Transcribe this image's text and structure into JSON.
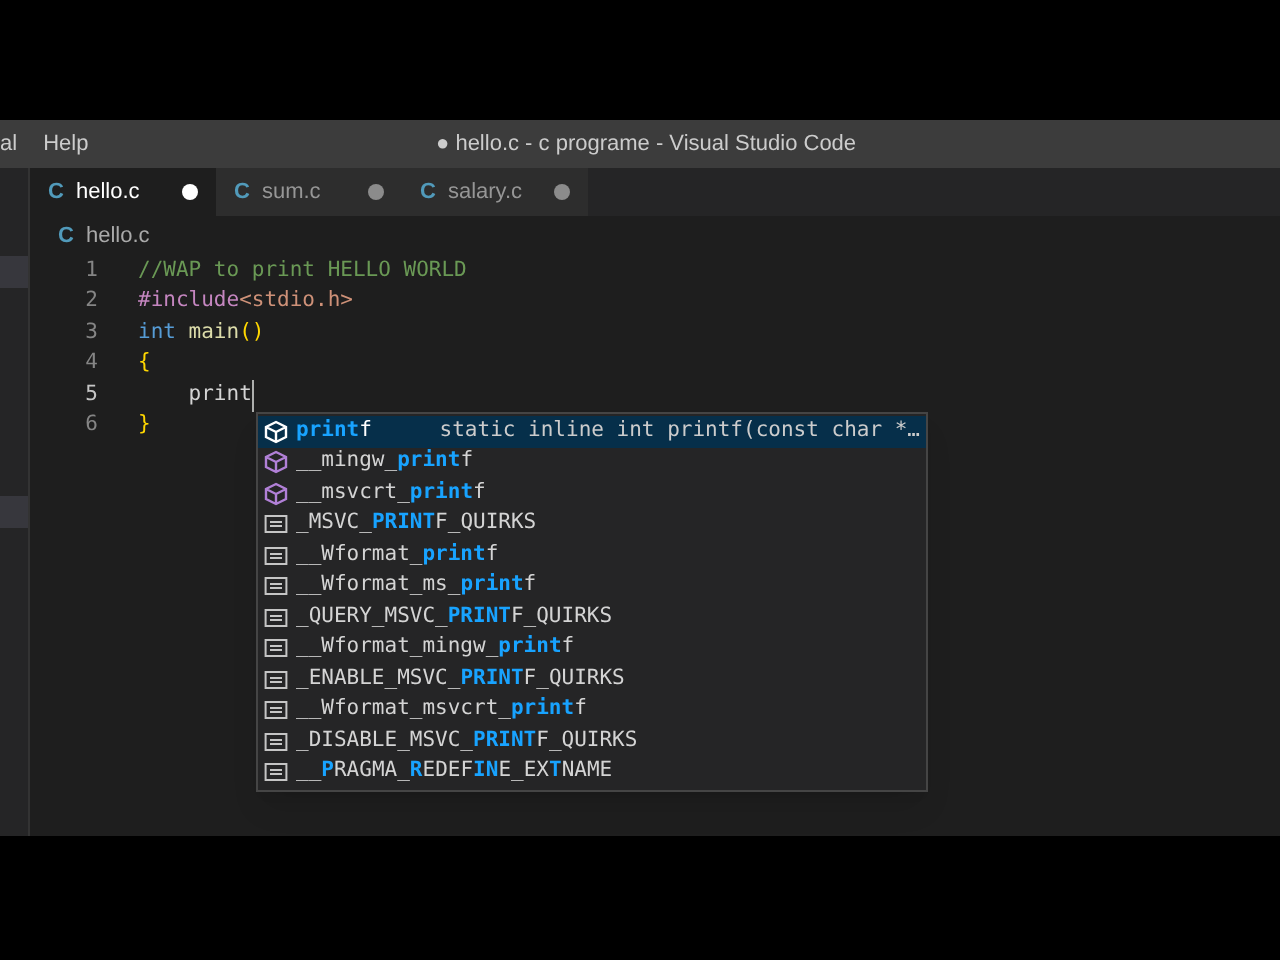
{
  "menu": [
    "al",
    "Help"
  ],
  "window": {
    "title": "● hello.c - c programe - Visual Studio Code"
  },
  "tabs": [
    {
      "icon": "C",
      "label": "hello.c",
      "selected": true,
      "modified": true
    },
    {
      "icon": "C",
      "label": "sum.c",
      "selected": false,
      "modified": true
    },
    {
      "icon": "C",
      "label": "salary.c",
      "selected": false,
      "modified": true
    }
  ],
  "breadcrumb": {
    "icon": "C",
    "label": "hello.c"
  },
  "code": [
    {
      "number": "1",
      "tokens": [
        {
          "kind": "comment",
          "text": "//WAP to print HELLO WORLD"
        }
      ]
    },
    {
      "number": "2",
      "tokens": [
        {
          "kind": "directive",
          "text": "#include"
        },
        {
          "kind": "string",
          "text": "<stdio.h>"
        }
      ]
    },
    {
      "number": "3",
      "tokens": [
        {
          "kind": "keyword",
          "text": "int"
        },
        {
          "kind": "function",
          "text": " main"
        },
        {
          "kind": "bracket",
          "text": "()"
        }
      ]
    },
    {
      "number": "4",
      "tokens": [
        {
          "kind": "bracket",
          "text": "{"
        }
      ]
    },
    {
      "number": "5",
      "current": true,
      "tokens": [
        {
          "kind": "plain",
          "text": "    print"
        }
      ]
    },
    {
      "number": "6",
      "tokens": [
        {
          "kind": "bracket",
          "text": "}"
        }
      ]
    }
  ],
  "suggestions": [
    {
      "kind": "function",
      "selected": true,
      "parts": [
        {
          "text": "print",
          "match": true
        },
        {
          "text": "f",
          "match": false
        }
      ],
      "detail": "static inline int printf(const char *…"
    },
    {
      "kind": "function",
      "selected": false,
      "parts": [
        {
          "text": "__mingw_",
          "match": false
        },
        {
          "text": "print",
          "match": true
        },
        {
          "text": "f",
          "match": false
        }
      ]
    },
    {
      "kind": "function",
      "selected": false,
      "parts": [
        {
          "text": "__msvcrt_",
          "match": false
        },
        {
          "text": "print",
          "match": true
        },
        {
          "text": "f",
          "match": false
        }
      ]
    },
    {
      "kind": "macro",
      "selected": false,
      "parts": [
        {
          "text": "_MSVC_",
          "match": false
        },
        {
          "text": "PRINT",
          "match": true
        },
        {
          "text": "F_QUIRKS",
          "match": false
        }
      ]
    },
    {
      "kind": "macro",
      "selected": false,
      "parts": [
        {
          "text": "__Wformat_",
          "match": false
        },
        {
          "text": "print",
          "match": true
        },
        {
          "text": "f",
          "match": false
        }
      ]
    },
    {
      "kind": "macro",
      "selected": false,
      "parts": [
        {
          "text": "__Wformat_ms_",
          "match": false
        },
        {
          "text": "print",
          "match": true
        },
        {
          "text": "f",
          "match": false
        }
      ]
    },
    {
      "kind": "macro",
      "selected": false,
      "parts": [
        {
          "text": "_QUERY_MSVC_",
          "match": false
        },
        {
          "text": "PRINT",
          "match": true
        },
        {
          "text": "F_QUIRKS",
          "match": false
        }
      ]
    },
    {
      "kind": "macro",
      "selected": false,
      "parts": [
        {
          "text": "__Wformat_mingw_",
          "match": false
        },
        {
          "text": "print",
          "match": true
        },
        {
          "text": "f",
          "match": false
        }
      ]
    },
    {
      "kind": "macro",
      "selected": false,
      "parts": [
        {
          "text": "_ENABLE_MSVC_",
          "match": false
        },
        {
          "text": "PRINT",
          "match": true
        },
        {
          "text": "F_QUIRKS",
          "match": false
        }
      ]
    },
    {
      "kind": "macro",
      "selected": false,
      "parts": [
        {
          "text": "__Wformat_msvcrt_",
          "match": false
        },
        {
          "text": "print",
          "match": true
        },
        {
          "text": "f",
          "match": false
        }
      ]
    },
    {
      "kind": "macro",
      "selected": false,
      "parts": [
        {
          "text": "_DISABLE_MSVC_",
          "match": false
        },
        {
          "text": "PRINT",
          "match": true
        },
        {
          "text": "F_QUIRKS",
          "match": false
        }
      ]
    },
    {
      "kind": "macro",
      "selected": false,
      "parts": [
        {
          "text": "__",
          "match": false
        },
        {
          "text": "P",
          "match": true
        },
        {
          "text": "RAGMA_",
          "match": false
        },
        {
          "text": "R",
          "match": true
        },
        {
          "text": "EDEF",
          "match": false
        },
        {
          "text": "IN",
          "match": true
        },
        {
          "text": "E_EX",
          "match": false
        },
        {
          "text": "T",
          "match": true
        },
        {
          "text": "NAME",
          "match": false
        }
      ]
    }
  ]
}
